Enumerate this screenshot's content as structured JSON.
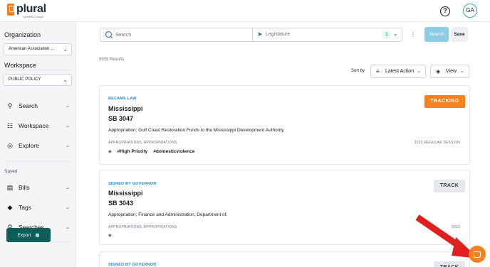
{
  "brand": {
    "name": "plural",
    "tagline": "formerly Civiqa",
    "accent": "#f58220"
  },
  "header": {
    "help_icon": "question-circle-icon",
    "help_glyph": "?",
    "avatar_initials": "GA"
  },
  "sidebar": {
    "organization_label": "Organization",
    "organization_value": "American Association ...",
    "workspace_label": "Workspace",
    "workspace_value": "PUBLIC POLICY",
    "nav": [
      {
        "label": "Search",
        "icon": "search-icon"
      },
      {
        "label": "Workspace",
        "icon": "people-icon"
      },
      {
        "label": "Explore",
        "icon": "compass-icon"
      }
    ],
    "saved_label": "Saved",
    "saved_items": [
      {
        "label": "Bills",
        "icon": "document-icon"
      },
      {
        "label": "Tags",
        "icon": "tag-icon"
      },
      {
        "label": "Searches",
        "icon": "search-list-icon"
      }
    ],
    "export_label": "Export",
    "export_color": "#0e5d58"
  },
  "search": {
    "placeholder": "Search",
    "legislature_placeholder": "Legislature",
    "legislature_count": "1",
    "search_button": "Search",
    "save_button": "Save"
  },
  "results": {
    "count_text": "3535 Results",
    "sort_by_label": "Sort by",
    "sort_value": "Latest Action",
    "view_value": "View"
  },
  "cards": [
    {
      "status": "BECAME LAW",
      "state": "Mississippi",
      "bill": "SB 3047",
      "description": "Appropriation; Gulf Coast Restoration Funds to the Mississippi Development Authority.",
      "subjects": "APPROPRIATIONS, APPROPRIATIONS",
      "session": "2023 REGULAR SESSION",
      "tags": [
        "#High Priority",
        "#domesticviolence"
      ],
      "action": "TRACKING"
    },
    {
      "status": "SIGNED BY GOVERNOR",
      "state": "Mississippi",
      "bill": "SB 3043",
      "description": "Appropriation; Finance and Administration, Department of.",
      "subjects": "APPROPRIATIONS, APPROPRIATIONS",
      "session": "2023",
      "tags": [],
      "action": "TRACK"
    },
    {
      "status": "SIGNED BY GOVERNOR",
      "action": "TRACK"
    }
  ]
}
